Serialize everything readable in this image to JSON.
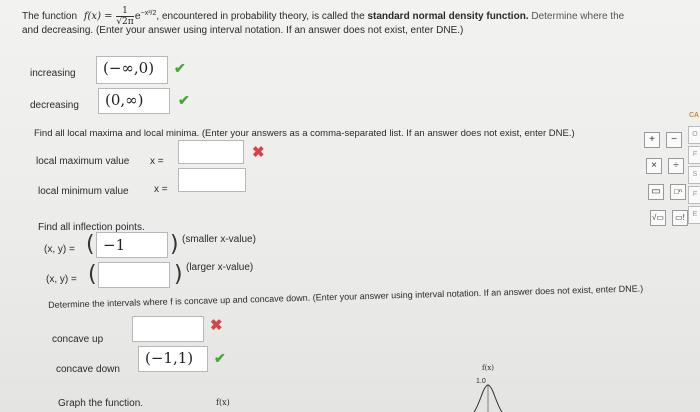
{
  "intro": {
    "prefix": "The function",
    "fx": "f(x) =",
    "frac_num": "1",
    "frac_den": "√2π",
    "exp": "e",
    "exp_sup": "−x²/2",
    "middle": ", encountered in probability theory, is called the",
    "bold": "standard normal density function.",
    "cut": "Determine where the",
    "line2": "and decreasing. (Enter your answer using interval notation. If an answer does not exist, enter DNE.)"
  },
  "increasing": {
    "label": "increasing",
    "value": "(−∞,0)"
  },
  "decreasing": {
    "label": "decreasing",
    "value": "(0,∞)"
  },
  "extrema": {
    "prompt": "Find all local maxima and local minima. (Enter your answers as a comma-separated list. If an answer does not exist, enter DNE.)",
    "max_label": "local maximum value",
    "min_label": "local minimum value",
    "x_eq": "x ="
  },
  "inflection": {
    "prompt": "Find all inflection points.",
    "xy_label": "(x, y) =",
    "first_value": "−1",
    "smaller": "(smaller x-value)",
    "larger": "(larger x-value)"
  },
  "concavity": {
    "prompt": "Determine the intervals where f is concave up and concave down. (Enter your answer using interval notation. If an answer does not exist, enter DNE.)",
    "up_label": "concave up",
    "down_label": "concave down",
    "down_value": "(−1,1)"
  },
  "graph": {
    "label": "Graph the function.",
    "fx_left": "f(x)",
    "fx_right": "f(x)",
    "tick": "1.0"
  },
  "palette": {
    "plus": "+",
    "minus": "−",
    "times": "×",
    "div": "÷",
    "frac": "▭",
    "pow": "□ⁿ",
    "sqrt": "√▭",
    "fact": "▭!"
  },
  "side": {
    "top": "CA",
    "items": [
      "O",
      "F",
      "S",
      "F",
      "E"
    ]
  }
}
